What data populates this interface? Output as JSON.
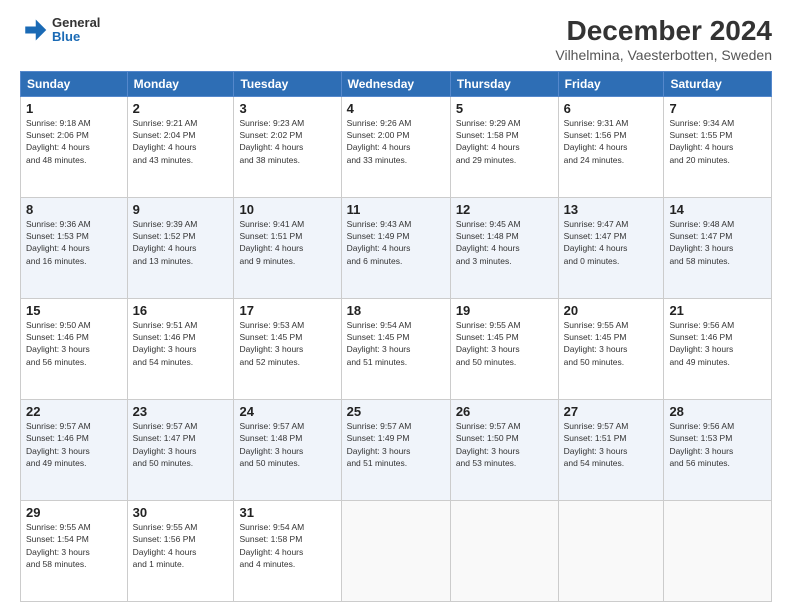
{
  "header": {
    "logo_line1": "General",
    "logo_line2": "Blue",
    "title": "December 2024",
    "subtitle": "Vilhelmina, Vaesterbotten, Sweden"
  },
  "days_of_week": [
    "Sunday",
    "Monday",
    "Tuesday",
    "Wednesday",
    "Thursday",
    "Friday",
    "Saturday"
  ],
  "weeks": [
    [
      {
        "day": "1",
        "info": "Sunrise: 9:18 AM\nSunset: 2:06 PM\nDaylight: 4 hours\nand 48 minutes."
      },
      {
        "day": "2",
        "info": "Sunrise: 9:21 AM\nSunset: 2:04 PM\nDaylight: 4 hours\nand 43 minutes."
      },
      {
        "day": "3",
        "info": "Sunrise: 9:23 AM\nSunset: 2:02 PM\nDaylight: 4 hours\nand 38 minutes."
      },
      {
        "day": "4",
        "info": "Sunrise: 9:26 AM\nSunset: 2:00 PM\nDaylight: 4 hours\nand 33 minutes."
      },
      {
        "day": "5",
        "info": "Sunrise: 9:29 AM\nSunset: 1:58 PM\nDaylight: 4 hours\nand 29 minutes."
      },
      {
        "day": "6",
        "info": "Sunrise: 9:31 AM\nSunset: 1:56 PM\nDaylight: 4 hours\nand 24 minutes."
      },
      {
        "day": "7",
        "info": "Sunrise: 9:34 AM\nSunset: 1:55 PM\nDaylight: 4 hours\nand 20 minutes."
      }
    ],
    [
      {
        "day": "8",
        "info": "Sunrise: 9:36 AM\nSunset: 1:53 PM\nDaylight: 4 hours\nand 16 minutes."
      },
      {
        "day": "9",
        "info": "Sunrise: 9:39 AM\nSunset: 1:52 PM\nDaylight: 4 hours\nand 13 minutes."
      },
      {
        "day": "10",
        "info": "Sunrise: 9:41 AM\nSunset: 1:51 PM\nDaylight: 4 hours\nand 9 minutes."
      },
      {
        "day": "11",
        "info": "Sunrise: 9:43 AM\nSunset: 1:49 PM\nDaylight: 4 hours\nand 6 minutes."
      },
      {
        "day": "12",
        "info": "Sunrise: 9:45 AM\nSunset: 1:48 PM\nDaylight: 4 hours\nand 3 minutes."
      },
      {
        "day": "13",
        "info": "Sunrise: 9:47 AM\nSunset: 1:47 PM\nDaylight: 4 hours\nand 0 minutes."
      },
      {
        "day": "14",
        "info": "Sunrise: 9:48 AM\nSunset: 1:47 PM\nDaylight: 3 hours\nand 58 minutes."
      }
    ],
    [
      {
        "day": "15",
        "info": "Sunrise: 9:50 AM\nSunset: 1:46 PM\nDaylight: 3 hours\nand 56 minutes."
      },
      {
        "day": "16",
        "info": "Sunrise: 9:51 AM\nSunset: 1:46 PM\nDaylight: 3 hours\nand 54 minutes."
      },
      {
        "day": "17",
        "info": "Sunrise: 9:53 AM\nSunset: 1:45 PM\nDaylight: 3 hours\nand 52 minutes."
      },
      {
        "day": "18",
        "info": "Sunrise: 9:54 AM\nSunset: 1:45 PM\nDaylight: 3 hours\nand 51 minutes."
      },
      {
        "day": "19",
        "info": "Sunrise: 9:55 AM\nSunset: 1:45 PM\nDaylight: 3 hours\nand 50 minutes."
      },
      {
        "day": "20",
        "info": "Sunrise: 9:55 AM\nSunset: 1:45 PM\nDaylight: 3 hours\nand 50 minutes."
      },
      {
        "day": "21",
        "info": "Sunrise: 9:56 AM\nSunset: 1:46 PM\nDaylight: 3 hours\nand 49 minutes."
      }
    ],
    [
      {
        "day": "22",
        "info": "Sunrise: 9:57 AM\nSunset: 1:46 PM\nDaylight: 3 hours\nand 49 minutes."
      },
      {
        "day": "23",
        "info": "Sunrise: 9:57 AM\nSunset: 1:47 PM\nDaylight: 3 hours\nand 50 minutes."
      },
      {
        "day": "24",
        "info": "Sunrise: 9:57 AM\nSunset: 1:48 PM\nDaylight: 3 hours\nand 50 minutes."
      },
      {
        "day": "25",
        "info": "Sunrise: 9:57 AM\nSunset: 1:49 PM\nDaylight: 3 hours\nand 51 minutes."
      },
      {
        "day": "26",
        "info": "Sunrise: 9:57 AM\nSunset: 1:50 PM\nDaylight: 3 hours\nand 53 minutes."
      },
      {
        "day": "27",
        "info": "Sunrise: 9:57 AM\nSunset: 1:51 PM\nDaylight: 3 hours\nand 54 minutes."
      },
      {
        "day": "28",
        "info": "Sunrise: 9:56 AM\nSunset: 1:53 PM\nDaylight: 3 hours\nand 56 minutes."
      }
    ],
    [
      {
        "day": "29",
        "info": "Sunrise: 9:55 AM\nSunset: 1:54 PM\nDaylight: 3 hours\nand 58 minutes."
      },
      {
        "day": "30",
        "info": "Sunrise: 9:55 AM\nSunset: 1:56 PM\nDaylight: 4 hours\nand 1 minute."
      },
      {
        "day": "31",
        "info": "Sunrise: 9:54 AM\nSunset: 1:58 PM\nDaylight: 4 hours\nand 4 minutes."
      },
      {
        "day": "",
        "info": ""
      },
      {
        "day": "",
        "info": ""
      },
      {
        "day": "",
        "info": ""
      },
      {
        "day": "",
        "info": ""
      }
    ]
  ]
}
